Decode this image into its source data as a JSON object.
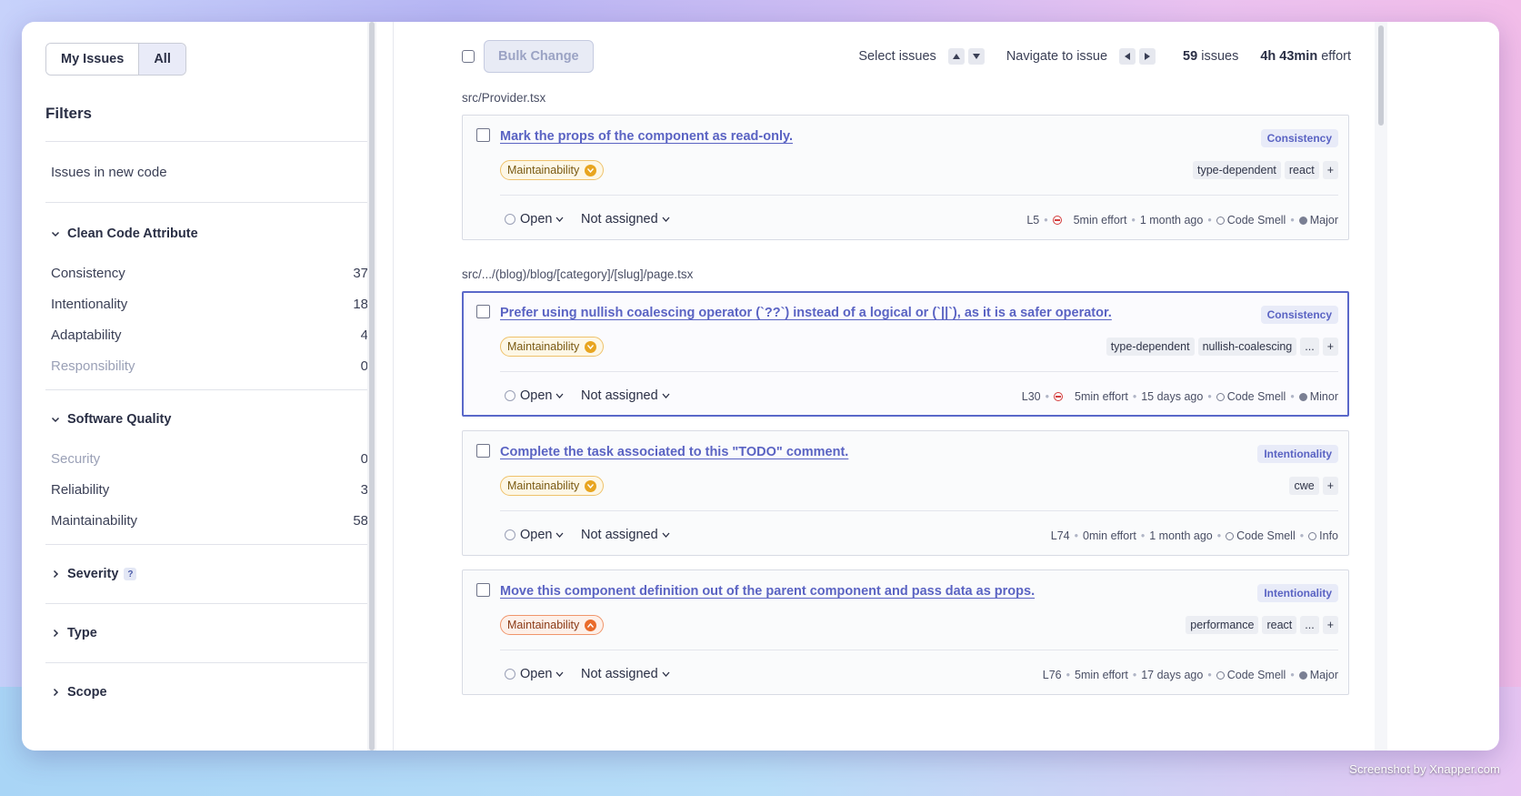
{
  "watermark": "Screenshot by Xnapper.com",
  "sidebar": {
    "toggle": {
      "my_issues": "My Issues",
      "all": "All"
    },
    "filters_title": "Filters",
    "new_code": "Issues in new code",
    "clean_code": {
      "title": "Clean Code Attribute",
      "items": [
        {
          "label": "Consistency",
          "count": "37"
        },
        {
          "label": "Intentionality",
          "count": "18"
        },
        {
          "label": "Adaptability",
          "count": "4"
        },
        {
          "label": "Responsibility",
          "count": "0"
        }
      ]
    },
    "software_quality": {
      "title": "Software Quality",
      "items": [
        {
          "label": "Security",
          "count": "0"
        },
        {
          "label": "Reliability",
          "count": "3"
        },
        {
          "label": "Maintainability",
          "count": "58"
        }
      ]
    },
    "severity": {
      "title": "Severity",
      "help": "?"
    },
    "type": {
      "title": "Type"
    },
    "scope": {
      "title": "Scope"
    }
  },
  "toolbar": {
    "bulk_change": "Bulk Change",
    "select_issues": "Select issues",
    "navigate_issue": "Navigate to issue",
    "issues_count": "59",
    "issues_label": "issues",
    "effort_value": "4h 43min",
    "effort_label": "effort"
  },
  "files": [
    {
      "path": "src/Provider.tsx"
    },
    {
      "path": "src/.../(blog)/blog/[category]/[slug]/page.tsx"
    }
  ],
  "issues": [
    {
      "title": "Mark the props of the component as read-only.",
      "attribute": "Consistency",
      "quality": "Maintainability",
      "tags": [
        "type-dependent",
        "react",
        "+"
      ],
      "status": "Open",
      "assignee": "Not assigned",
      "line": "L5",
      "effort": "5min effort",
      "age": "1 month ago",
      "type": "Code Smell",
      "severity": "Major"
    },
    {
      "title": "Prefer using nullish coalescing operator (`??`) instead of a logical or (`||`), as it is a safer operator.",
      "attribute": "Consistency",
      "quality": "Maintainability",
      "tags": [
        "type-dependent",
        "nullish-coalescing",
        "...",
        "+"
      ],
      "status": "Open",
      "assignee": "Not assigned",
      "line": "L30",
      "effort": "5min effort",
      "age": "15 days ago",
      "type": "Code Smell",
      "severity": "Minor"
    },
    {
      "title": "Complete the task associated to this \"TODO\" comment.",
      "attribute": "Intentionality",
      "quality": "Maintainability",
      "tags": [
        "cwe",
        "+"
      ],
      "status": "Open",
      "assignee": "Not assigned",
      "line": "L74",
      "effort": "0min effort",
      "age": "1 month ago",
      "type": "Code Smell",
      "severity": "Info"
    },
    {
      "title": "Move this component definition out of the parent component and pass data as props.",
      "attribute": "Intentionality",
      "quality": "Maintainability",
      "tags": [
        "performance",
        "react",
        "...",
        "+"
      ],
      "status": "Open",
      "assignee": "Not assigned",
      "line": "L76",
      "effort": "5min effort",
      "age": "17 days ago",
      "type": "Code Smell",
      "severity": "Major"
    }
  ]
}
